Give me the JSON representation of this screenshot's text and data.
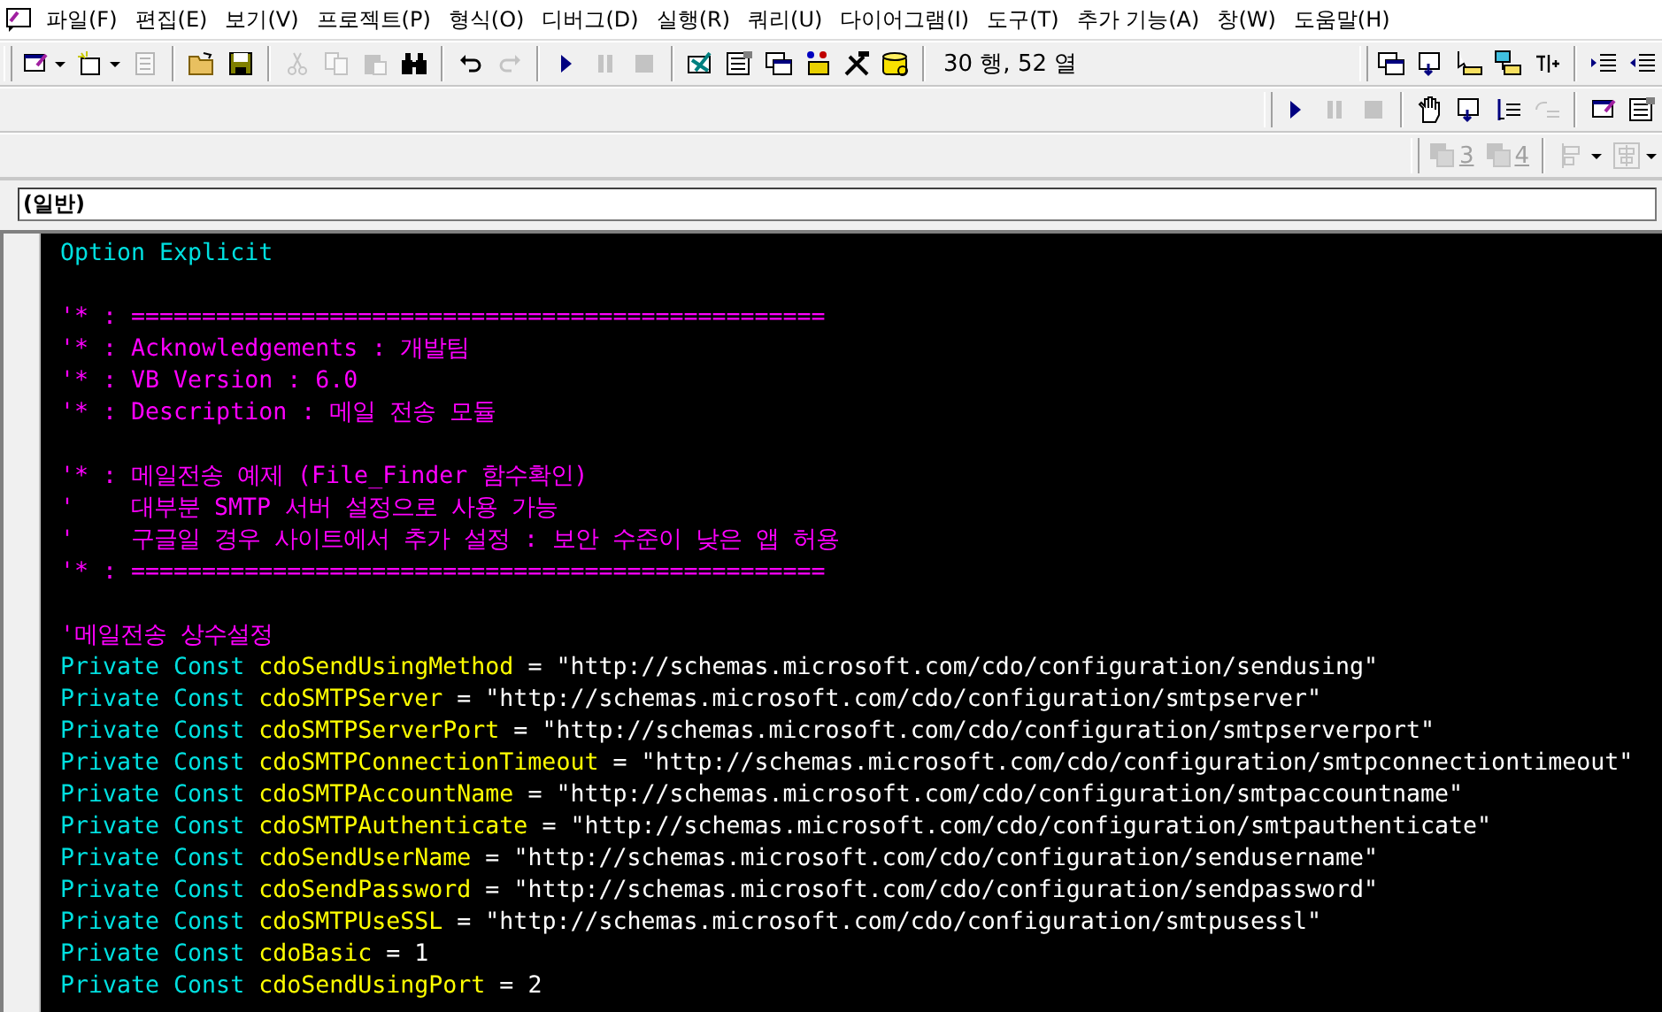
{
  "menu": [
    {
      "label": "파일(F)"
    },
    {
      "label": "편집(E)"
    },
    {
      "label": "보기(V)"
    },
    {
      "label": "프로젝트(P)"
    },
    {
      "label": "형식(O)"
    },
    {
      "label": "디버그(D)"
    },
    {
      "label": "실행(R)"
    },
    {
      "label": "쿼리(U)"
    },
    {
      "label": "다이어그램(I)"
    },
    {
      "label": "도구(T)"
    },
    {
      "label": "추가 기능(A)"
    },
    {
      "label": "창(W)"
    },
    {
      "label": "도움말(H)"
    }
  ],
  "toolbar_standard": [
    {
      "kind": "form",
      "disabled": false,
      "dropdown": true
    },
    {
      "kind": "module",
      "disabled": false,
      "dropdown": true
    },
    {
      "kind": "list",
      "disabled": true
    },
    {
      "kind": "sep"
    },
    {
      "kind": "open",
      "disabled": false
    },
    {
      "kind": "save",
      "disabled": false
    },
    {
      "kind": "sep"
    },
    {
      "kind": "cut",
      "disabled": true
    },
    {
      "kind": "copy",
      "disabled": true
    },
    {
      "kind": "paste",
      "disabled": true
    },
    {
      "kind": "find",
      "disabled": false
    },
    {
      "kind": "sep"
    },
    {
      "kind": "undo",
      "disabled": false
    },
    {
      "kind": "redo",
      "disabled": true
    },
    {
      "kind": "sep"
    },
    {
      "kind": "run",
      "disabled": false
    },
    {
      "kind": "pause",
      "disabled": true
    },
    {
      "kind": "stop",
      "disabled": true
    },
    {
      "kind": "sep"
    },
    {
      "kind": "design",
      "disabled": false
    },
    {
      "kind": "properties",
      "disabled": false
    },
    {
      "kind": "windows",
      "disabled": false
    },
    {
      "kind": "toolbox",
      "disabled": false
    },
    {
      "kind": "tools",
      "disabled": false
    },
    {
      "kind": "database",
      "disabled": false
    },
    {
      "kind": "sep"
    },
    {
      "kind": "text",
      "text": "30 행, 52 열"
    }
  ],
  "toolbar_edit": [
    {
      "kind": "windows",
      "disabled": false
    },
    {
      "kind": "step",
      "disabled": false
    },
    {
      "kind": "cursor",
      "disabled": false
    },
    {
      "kind": "objects",
      "disabled": false
    },
    {
      "kind": "word",
      "disabled": false
    },
    {
      "kind": "sep"
    },
    {
      "kind": "indent",
      "disabled": false
    },
    {
      "kind": "outdent",
      "disabled": false
    }
  ],
  "toolbar_debug": [
    {
      "kind": "run",
      "disabled": false
    },
    {
      "kind": "pause",
      "disabled": true
    },
    {
      "kind": "stop",
      "disabled": true
    },
    {
      "kind": "sep"
    },
    {
      "kind": "hand",
      "disabled": false
    },
    {
      "kind": "step",
      "disabled": false
    },
    {
      "kind": "stepover",
      "disabled": false
    },
    {
      "kind": "stepout",
      "disabled": true
    },
    {
      "kind": "sep"
    },
    {
      "kind": "form",
      "disabled": false
    },
    {
      "kind": "properties",
      "disabled": false
    }
  ],
  "toolbar_format": [
    {
      "kind": "group",
      "text": "3",
      "disabled": true
    },
    {
      "kind": "group",
      "text": "4",
      "disabled": true
    },
    {
      "kind": "sep"
    },
    {
      "kind": "align",
      "disabled": true,
      "dropdown": true
    },
    {
      "kind": "center",
      "disabled": true,
      "dropdown": true
    }
  ],
  "object_combo": {
    "value": "(일반)"
  },
  "code_lines": [
    {
      "gap_before": false,
      "tokens": [
        {
          "kind": "keyword",
          "text": "Option Explicit"
        }
      ]
    },
    {
      "gap_before": true,
      "tokens": [
        {
          "kind": "comment",
          "text": "'* : ================================================="
        }
      ]
    },
    {
      "gap_before": false,
      "tokens": [
        {
          "kind": "comment",
          "text": "'* : Acknowledgements : 개발팀"
        }
      ]
    },
    {
      "gap_before": false,
      "tokens": [
        {
          "kind": "comment",
          "text": "'* : VB Version : 6.0"
        }
      ]
    },
    {
      "gap_before": false,
      "tokens": [
        {
          "kind": "comment",
          "text": "'* : Description : 메일 전송 모듈"
        }
      ]
    },
    {
      "gap_before": true,
      "tokens": [
        {
          "kind": "comment",
          "text": "'* : 메일전송 예제 (File_Finder 함수확인)"
        }
      ]
    },
    {
      "gap_before": false,
      "tokens": [
        {
          "kind": "comment",
          "text": "'    대부분 SMTP 서버 설정으로 사용 가능"
        }
      ]
    },
    {
      "gap_before": false,
      "tokens": [
        {
          "kind": "comment",
          "text": "'    구글일 경우 사이트에서 추가 설정 : 보안 수준이 낮은 앱 허용"
        }
      ]
    },
    {
      "gap_before": false,
      "tokens": [
        {
          "kind": "comment",
          "text": "'* : ================================================="
        }
      ]
    },
    {
      "gap_before": true,
      "tokens": [
        {
          "kind": "comment",
          "text": "'메일전송 상수설정"
        }
      ]
    },
    {
      "gap_before": false,
      "tokens": [
        {
          "kind": "keyword",
          "text": "Private Const "
        },
        {
          "kind": "identifier",
          "text": "cdoSendUsingMethod"
        },
        {
          "kind": "plain",
          "text": " = \"http://schemas.microsoft.com/cdo/configuration/sendusing\""
        }
      ]
    },
    {
      "gap_before": false,
      "tokens": [
        {
          "kind": "keyword",
          "text": "Private Const "
        },
        {
          "kind": "identifier",
          "text": "cdoSMTPServer"
        },
        {
          "kind": "plain",
          "text": " = \"http://schemas.microsoft.com/cdo/configuration/smtpserver\""
        }
      ]
    },
    {
      "gap_before": false,
      "tokens": [
        {
          "kind": "keyword",
          "text": "Private Const "
        },
        {
          "kind": "identifier",
          "text": "cdoSMTPServerPort"
        },
        {
          "kind": "plain",
          "text": " = \"http://schemas.microsoft.com/cdo/configuration/smtpserverport\""
        }
      ]
    },
    {
      "gap_before": false,
      "tokens": [
        {
          "kind": "keyword",
          "text": "Private Const "
        },
        {
          "kind": "identifier",
          "text": "cdoSMTPConnectionTimeout"
        },
        {
          "kind": "plain",
          "text": " = \"http://schemas.microsoft.com/cdo/configuration/smtpconnectiontimeout\""
        }
      ]
    },
    {
      "gap_before": false,
      "tokens": [
        {
          "kind": "keyword",
          "text": "Private Const "
        },
        {
          "kind": "identifier",
          "text": "cdoSMTPAccountName"
        },
        {
          "kind": "plain",
          "text": " = \"http://schemas.microsoft.com/cdo/configuration/smtpaccountname\""
        }
      ]
    },
    {
      "gap_before": false,
      "tokens": [
        {
          "kind": "keyword",
          "text": "Private Const "
        },
        {
          "kind": "identifier",
          "text": "cdoSMTPAuthenticate"
        },
        {
          "kind": "plain",
          "text": " = \"http://schemas.microsoft.com/cdo/configuration/smtpauthenticate\""
        }
      ]
    },
    {
      "gap_before": false,
      "tokens": [
        {
          "kind": "keyword",
          "text": "Private Const "
        },
        {
          "kind": "identifier",
          "text": "cdoSendUserName"
        },
        {
          "kind": "plain",
          "text": " = \"http://schemas.microsoft.com/cdo/configuration/sendusername\""
        }
      ]
    },
    {
      "gap_before": false,
      "tokens": [
        {
          "kind": "keyword",
          "text": "Private Const "
        },
        {
          "kind": "identifier",
          "text": "cdoSendPassword"
        },
        {
          "kind": "plain",
          "text": " = \"http://schemas.microsoft.com/cdo/configuration/sendpassword\""
        }
      ]
    },
    {
      "gap_before": false,
      "tokens": [
        {
          "kind": "keyword",
          "text": "Private Const "
        },
        {
          "kind": "identifier",
          "text": "cdoSMTPUseSSL"
        },
        {
          "kind": "plain",
          "text": " = \"http://schemas.microsoft.com/cdo/configuration/smtpusessl\""
        }
      ]
    },
    {
      "gap_before": false,
      "tokens": [
        {
          "kind": "keyword",
          "text": "Private Const "
        },
        {
          "kind": "identifier",
          "text": "cdoBasic"
        },
        {
          "kind": "plain",
          "text": " = 1"
        }
      ]
    },
    {
      "gap_before": false,
      "tokens": [
        {
          "kind": "keyword",
          "text": "Private Const "
        },
        {
          "kind": "identifier",
          "text": "cdoSendUsingPort"
        },
        {
          "kind": "plain",
          "text": " = 2"
        }
      ]
    }
  ]
}
